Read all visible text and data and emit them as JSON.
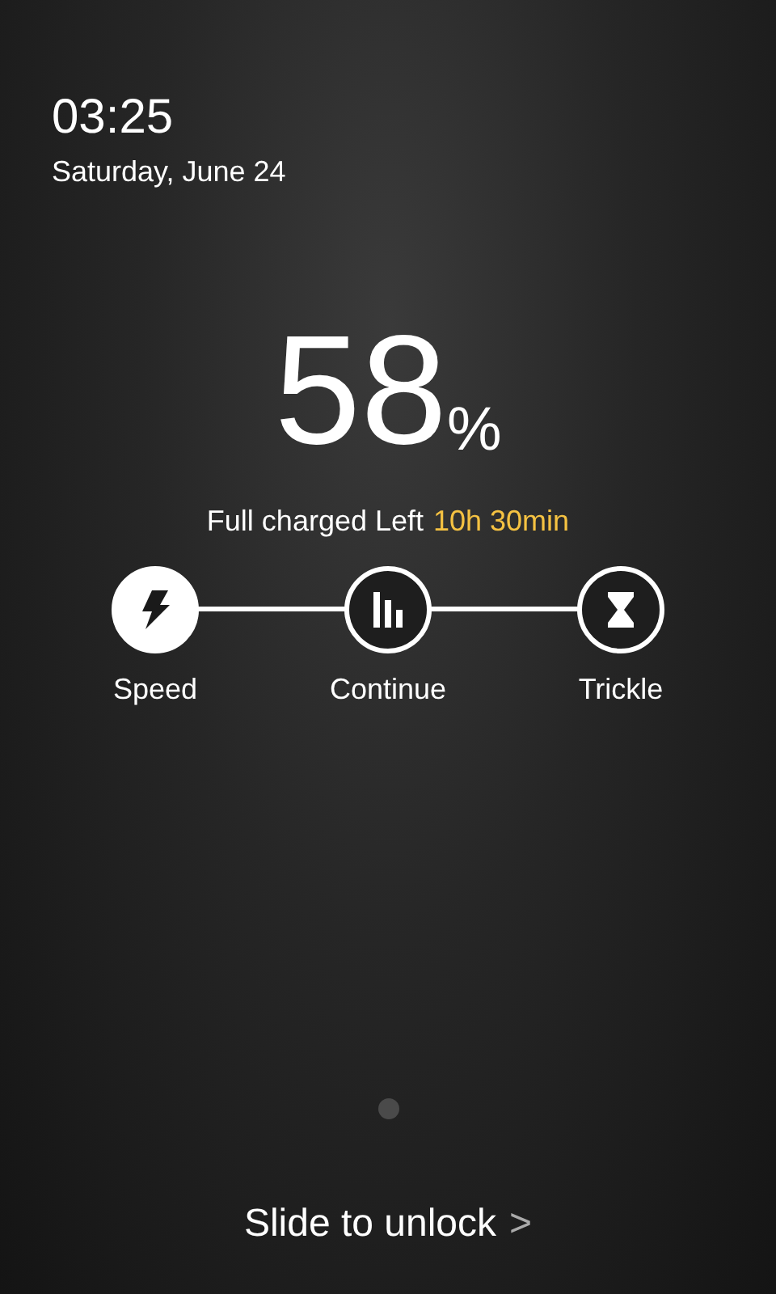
{
  "clock": {
    "time": "03:25",
    "date": "Saturday, June 24"
  },
  "battery": {
    "percent": "58",
    "unit": "%",
    "status_label": "Full charged Left",
    "time_left": "10h 30min"
  },
  "stages": [
    {
      "kind": "speed",
      "label": "Speed",
      "selected": true
    },
    {
      "kind": "continue",
      "label": "Continue",
      "selected": false
    },
    {
      "kind": "trickle",
      "label": "Trickle",
      "selected": false
    }
  ],
  "pager": [
    {
      "selected": true
    }
  ],
  "unlock": {
    "label": "Slide to unlock",
    "arrow": ">"
  }
}
